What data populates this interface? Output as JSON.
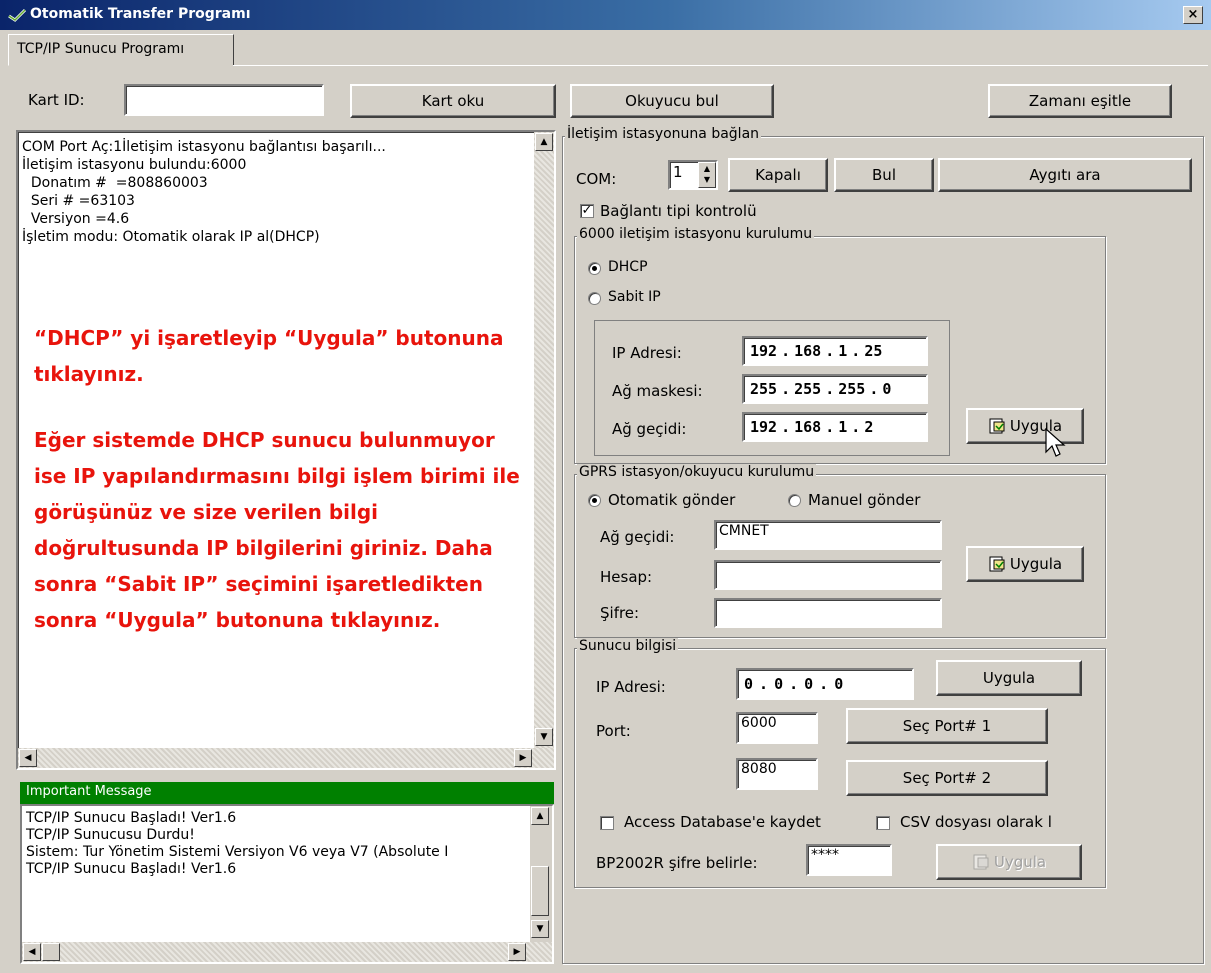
{
  "window": {
    "title": "Otomatik Transfer Programı",
    "close": "×"
  },
  "tabs": [
    {
      "label": "TCP/IP Sunucu Programı"
    }
  ],
  "toolbar": {
    "card_id_label": "Kart ID:",
    "card_id_value": "",
    "read_card": "Kart oku",
    "find_reader": "Okuyucu bul",
    "sync_time": "Zamanı eşitle"
  },
  "log": {
    "lines": [
      "COM Port Aç:1İletişim istasyonu bağlantısı başarılı...",
      "İletişim istasyonu bulundu:6000",
      "  Donatım #  =808860003",
      "  Seri # =63103",
      "  Versiyon =4.6",
      "İşletim modu: Otomatik olarak IP al(DHCP)"
    ],
    "instruction_1": [
      "“DHCP” yi işaretleyip “Uygula” butonuna",
      "tıklayınız."
    ],
    "instruction_2": [
      "Eğer sistemde DHCP sunucu bulunmuyor",
      "ise IP yapılandırmasını bilgi işlem birimi ile",
      "görüşünüz ve size verilen bilgi",
      "doğrultusunda IP bilgilerini giriniz. Daha",
      "sonra “Sabit IP” seçimini işaretledikten",
      "sonra “Uygula” butonuna tıklayınız."
    ]
  },
  "important": {
    "header": "Important Message",
    "lines": [
      "TCP/IP Sunucu Başladı! Ver1.6",
      "TCP/IP Sunucusu Durdu!",
      "Sistem: Tur Yönetim Sistemi Versiyon V6 veya V7 (Absolute I",
      "TCP/IP Sunucu Başladı! Ver1.6"
    ]
  },
  "connect": {
    "group_title": "İletişim istasyonuna bağlan",
    "com_label": "COM:",
    "com_value": "1",
    "closed_button": "Kapalı",
    "find_button": "Bul",
    "search_device_button": "Aygıtı ara",
    "connection_check_label": "Bağlantı tipi kontrolü",
    "connection_check_mark": "✓"
  },
  "station_setup": {
    "group_title": "6000 iletişim istasyonu kurulumu",
    "dhcp_label": "DHCP",
    "static_ip_label": "Sabit IP",
    "ip_label": "IP Adresi:",
    "ip": [
      "192",
      "168",
      "1",
      "25"
    ],
    "mask_label": "Ağ maskesi:",
    "mask": [
      "255",
      "255",
      "255",
      "0"
    ],
    "gateway_label": "Ağ geçidi:",
    "gateway": [
      "192",
      "168",
      "1",
      "2"
    ],
    "apply_button": "Uygula"
  },
  "gprs": {
    "group_title": "GPRS istasyon/okuyucu kurulumu",
    "auto_send": "Otomatik gönder",
    "manual_send": "Manuel gönder",
    "gateway_label": "Ağ geçidi:",
    "gateway_value": "CMNET",
    "account_label": "Hesap:",
    "account_value": "",
    "password_label": "Şifre:",
    "password_value": "",
    "apply_button": "Uygula"
  },
  "server": {
    "group_title": "Sunucu bilgisi",
    "ip_label": "IP Adresi:",
    "ip": [
      "0",
      "0",
      "0",
      "0"
    ],
    "apply_button": "Uygula",
    "port_label": "Port:",
    "port1_value": "6000",
    "port1_button": "Seç Port# 1",
    "port2_value": "8080",
    "port2_button": "Seç Port# 2",
    "access_db_label": "Access Database'e kaydet",
    "csv_label": "CSV dosyası olarak l",
    "bp_label": "BP2002R şifre belirle:",
    "bp_value": "****",
    "bp_apply_button": "Uygula"
  }
}
